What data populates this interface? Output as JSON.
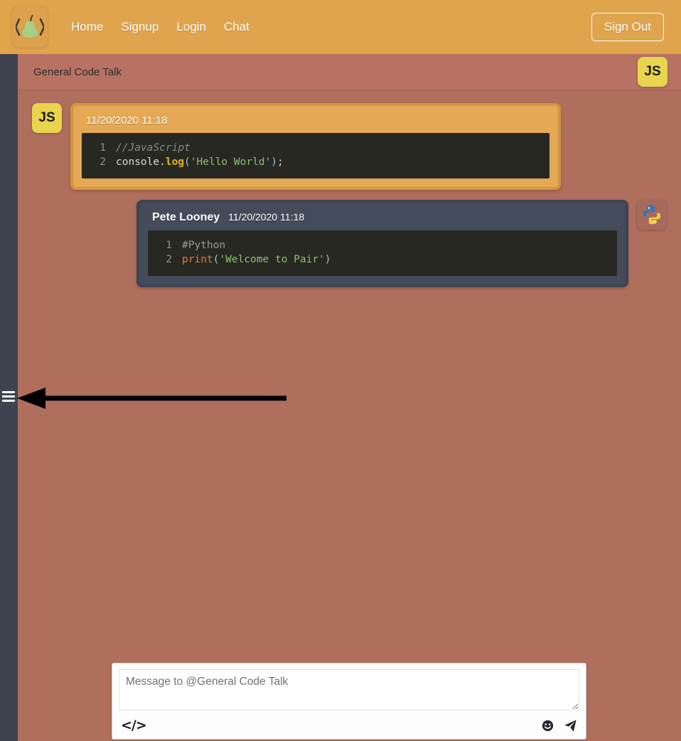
{
  "navbar": {
    "logo_name": "pear-code-logo",
    "links": [
      {
        "label": "Home",
        "name": "nav-link-home"
      },
      {
        "label": "Signup",
        "name": "nav-link-signup"
      },
      {
        "label": "Login",
        "name": "nav-link-login"
      },
      {
        "label": "Chat",
        "name": "nav-link-chat"
      }
    ],
    "signout_label": "Sign Out",
    "bg_color": "#e0a44d"
  },
  "sidebar": {
    "menu_icon": "hamburger-icon",
    "bg_color": "#3e4350"
  },
  "chat_header": {
    "title": "General Code Talk",
    "badge_label": "JS",
    "badge_color": "#e8d44d"
  },
  "messages": [
    {
      "id": "msg-js",
      "align": "left",
      "author": "",
      "timestamp": "11/20/2020 11:18",
      "avatar_label": "JS",
      "avatar_name": "javascript-avatar",
      "language": "javascript",
      "bubble_color": "#e5a855",
      "code_lines": [
        {
          "num": "1",
          "tokens": [
            {
              "text": "//JavaScript",
              "cls": "tok-comment"
            }
          ]
        },
        {
          "num": "2",
          "tokens": [
            {
              "text": "console",
              "cls": "tok-plain"
            },
            {
              "text": ".",
              "cls": "tok-plain"
            },
            {
              "text": "log",
              "cls": "tok-fn"
            },
            {
              "text": "(",
              "cls": "tok-punc"
            },
            {
              "text": "'Hello World'",
              "cls": "tok-str"
            },
            {
              "text": ")",
              "cls": "tok-punc"
            },
            {
              "text": ";",
              "cls": "tok-plain"
            }
          ]
        }
      ]
    },
    {
      "id": "msg-py",
      "align": "right",
      "author": "Pete Looney",
      "timestamp": "11/20/2020 11:18",
      "avatar_label": "",
      "avatar_name": "python-avatar",
      "language": "python",
      "bubble_color": "#444b5a",
      "code_lines": [
        {
          "num": "1",
          "tokens": [
            {
              "text": "#Python",
              "cls": "tok-comment-plain"
            }
          ]
        },
        {
          "num": "2",
          "tokens": [
            {
              "text": "print",
              "cls": "tok-kw"
            },
            {
              "text": "(",
              "cls": "tok-punc"
            },
            {
              "text": "'Welcome to Pair'",
              "cls": "tok-str"
            },
            {
              "text": ")",
              "cls": "tok-punc"
            }
          ]
        }
      ]
    }
  ],
  "composer": {
    "placeholder": "Message to @General Code Talk",
    "value": "",
    "code_icon_label": "</>",
    "emoji_icon": "smiley-icon",
    "send_icon": "paper-plane-icon"
  },
  "annotation": {
    "type": "arrow",
    "points_to": "hamburger-icon",
    "color": "#000000"
  }
}
